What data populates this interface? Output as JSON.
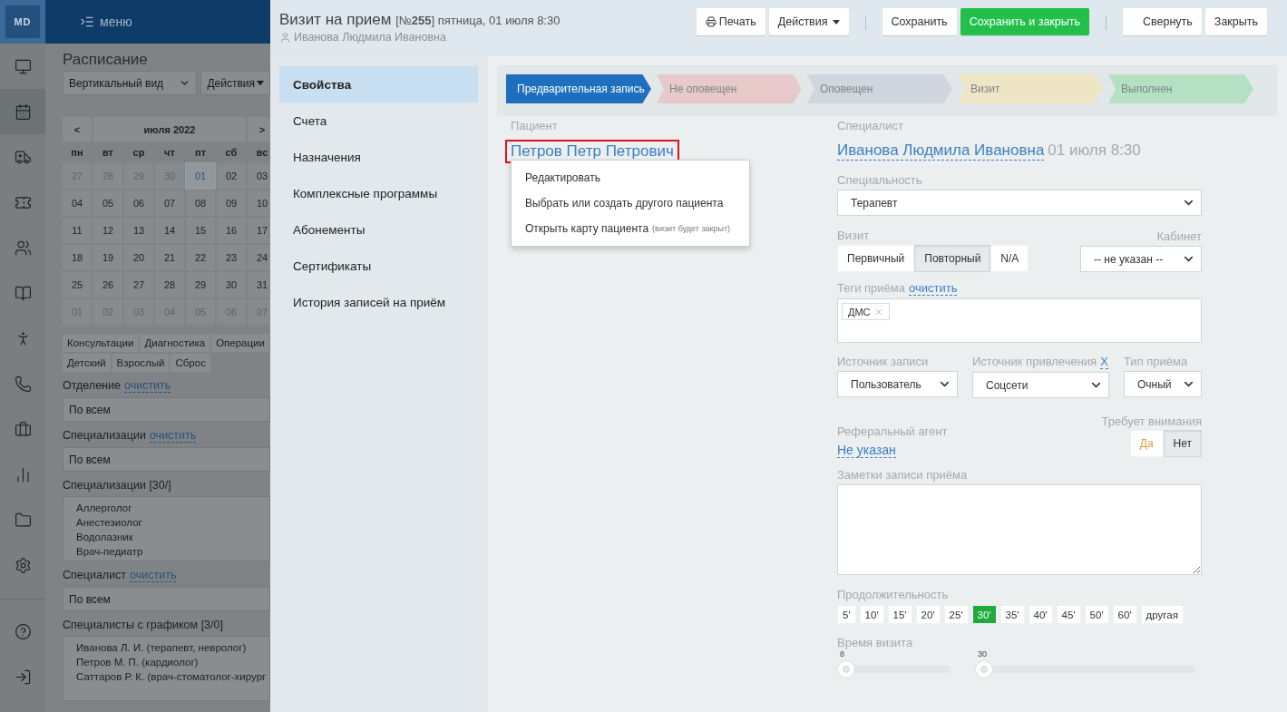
{
  "app_header": {
    "logo": "MD",
    "menu_label": "меню"
  },
  "nav_items": [
    {
      "selected": false
    },
    {
      "selected": true
    },
    {
      "selected": false
    },
    {
      "selected": false
    },
    {
      "selected": false
    },
    {
      "selected": false
    },
    {
      "selected": false
    },
    {
      "selected": false
    },
    {
      "selected": false
    },
    {
      "selected": false
    },
    {
      "selected": false
    },
    {
      "selected": false
    }
  ],
  "schedule": {
    "title": "Расписание",
    "view_select": "Вертикальный вид",
    "actions": "Действия",
    "calendar": {
      "month": "июля 2022",
      "prev": "<",
      "next": ">",
      "weekdays": [
        "пн",
        "вт",
        "ср",
        "чт",
        "пт",
        "сб",
        "вс"
      ],
      "weeks": [
        [
          {
            "day": "27",
            "muted": true,
            "selected": false
          },
          {
            "day": "28",
            "muted": true,
            "selected": false
          },
          {
            "day": "29",
            "muted": true,
            "selected": false
          },
          {
            "day": "30",
            "muted": true,
            "selected": false
          },
          {
            "day": "01",
            "muted": false,
            "selected": true
          },
          {
            "day": "02",
            "muted": false,
            "selected": false
          },
          {
            "day": "03",
            "muted": false,
            "selected": false
          }
        ],
        [
          {
            "day": "04",
            "muted": false,
            "selected": false
          },
          {
            "day": "05",
            "muted": false,
            "selected": false
          },
          {
            "day": "06",
            "muted": false,
            "selected": false
          },
          {
            "day": "07",
            "muted": false,
            "selected": false
          },
          {
            "day": "08",
            "muted": false,
            "selected": false
          },
          {
            "day": "09",
            "muted": false,
            "selected": false
          },
          {
            "day": "10",
            "muted": false,
            "selected": false
          }
        ],
        [
          {
            "day": "11",
            "muted": false,
            "selected": false
          },
          {
            "day": "12",
            "muted": false,
            "selected": false
          },
          {
            "day": "13",
            "muted": false,
            "selected": false
          },
          {
            "day": "14",
            "muted": false,
            "selected": false
          },
          {
            "day": "15",
            "muted": false,
            "selected": false
          },
          {
            "day": "16",
            "muted": false,
            "selected": false
          },
          {
            "day": "17",
            "muted": false,
            "selected": false
          }
        ],
        [
          {
            "day": "18",
            "muted": false,
            "selected": false
          },
          {
            "day": "19",
            "muted": false,
            "selected": false
          },
          {
            "day": "20",
            "muted": false,
            "selected": false
          },
          {
            "day": "21",
            "muted": false,
            "selected": false
          },
          {
            "day": "22",
            "muted": false,
            "selected": false
          },
          {
            "day": "23",
            "muted": false,
            "selected": false
          },
          {
            "day": "24",
            "muted": false,
            "selected": false
          }
        ],
        [
          {
            "day": "25",
            "muted": false,
            "selected": false
          },
          {
            "day": "26",
            "muted": false,
            "selected": false
          },
          {
            "day": "27",
            "muted": false,
            "selected": false
          },
          {
            "day": "28",
            "muted": false,
            "selected": false
          },
          {
            "day": "29",
            "muted": false,
            "selected": false
          },
          {
            "day": "30",
            "muted": false,
            "selected": false
          },
          {
            "day": "31",
            "muted": false,
            "selected": false
          }
        ],
        [
          {
            "day": "01",
            "muted": true,
            "selected": false
          },
          {
            "day": "02",
            "muted": true,
            "selected": false
          },
          {
            "day": "03",
            "muted": true,
            "selected": false
          },
          {
            "day": "04",
            "muted": true,
            "selected": false
          },
          {
            "day": "05",
            "muted": true,
            "selected": false
          },
          {
            "day": "06",
            "muted": true,
            "selected": false
          },
          {
            "day": "07",
            "muted": true,
            "selected": false
          }
        ]
      ]
    },
    "type_filters": [
      [
        "Консультации",
        "Диагностика",
        "Операции"
      ],
      [
        "Детский",
        "Взрослый",
        "Сброс"
      ]
    ],
    "filters": [
      {
        "kind": "select",
        "label": "Отделение",
        "clear": "очистить",
        "value": "По всем"
      },
      {
        "kind": "select",
        "label": "Специализации",
        "clear": "очистить",
        "value": "По всем"
      },
      {
        "kind": "list",
        "label": "Специализации [30/]",
        "items": [
          "Аллерголог",
          "Анестезиолог",
          "Водолазник",
          "Врач-педиатр"
        ]
      },
      {
        "kind": "select",
        "label": "Специалист",
        "clear": "очистить",
        "value": "По всем"
      },
      {
        "kind": "list",
        "label": "Специалисты с графиком [3/0]",
        "items": [
          "Иванова Л. И. (терапевт, невролог)",
          "Петров М. П. (кардиолог)",
          "Саттаров Р. К. (врач-стоматолог-хирург"
        ]
      }
    ]
  },
  "modal": {
    "title": "Визит на прием",
    "subtitle": "[№**255**] пятница, 01 июля 8:30",
    "author": "Иванова Людмила Ивановна",
    "toolbar": [
      {
        "kind": "print",
        "label": "Печать"
      },
      {
        "kind": "menu",
        "label": "Действия"
      },
      {
        "kind": "separator"
      },
      {
        "kind": "default",
        "label": "Сохранить"
      },
      {
        "kind": "primary",
        "label": "Сохранить и закрыть"
      },
      {
        "kind": "separator"
      },
      {
        "kind": "default",
        "label": "Свернуть"
      },
      {
        "kind": "default",
        "label": "Закрыть"
      }
    ],
    "tabs": [
      {
        "label": "Свойства",
        "selected": true
      },
      {
        "label": "Счета",
        "selected": false
      },
      {
        "label": "Назначения",
        "selected": false
      },
      {
        "label": "Комплексные программы",
        "selected": false
      },
      {
        "label": "Абонементы",
        "selected": false
      },
      {
        "label": "Сертификаты",
        "selected": false
      },
      {
        "label": "История записей на приём",
        "selected": false
      }
    ],
    "status_steps": [
      {
        "label": "Предварительная запись",
        "selected": true,
        "color": "#1f6fbf"
      },
      {
        "label": "Не оповещен",
        "selected": false,
        "color": "#e7c9c9"
      },
      {
        "label": "Оповещен",
        "selected": false,
        "color": "#d1d6de"
      },
      {
        "label": "Визит",
        "selected": false,
        "color": "#ede5c4"
      },
      {
        "label": "Выполнен",
        "selected": false,
        "color": "#b4e1c4"
      }
    ],
    "patient": {
      "label": "Пациент",
      "name": "Петров Петр Петрович",
      "highlighted": true,
      "menu": [
        {
          "label": "Редактировать"
        },
        {
          "label": "Выбрать или создать другого пациента"
        },
        {
          "label": "Открыть карту пациента",
          "note": "(визит будет закрыт)"
        }
      ]
    },
    "specialist": {
      "label": "Специалист",
      "name": "Иванова Людмила Ивановна",
      "datetime": "01 июля 8:30"
    },
    "specialty": {
      "label": "Специальность",
      "value": "Терапевт"
    },
    "visit": {
      "label": "Визит",
      "options": [
        {
          "label": "Первичный",
          "selected": false
        },
        {
          "label": "Повторный",
          "selected": true
        },
        {
          "label": "N/A",
          "selected": false
        }
      ]
    },
    "cabinet": {
      "label": "Кабинет",
      "value": "-- не указан --"
    },
    "tags": {
      "label": "Теги приёма",
      "clear": "очистить",
      "items": [
        "ДМС"
      ]
    },
    "selects": [
      {
        "label": "Источник записи",
        "value": "Пользователь"
      },
      {
        "label": "Источник привлечения",
        "clear": "Х",
        "value": "Соцсети"
      },
      {
        "label": "Тип приёма",
        "value": "Очный"
      }
    ],
    "referral": {
      "label": "Реферальный агент",
      "value": "Не указан"
    },
    "attention": {
      "label": "Требует внимания",
      "options": [
        {
          "label": "Да",
          "selected": false
        },
        {
          "label": "Нет",
          "selected": true
        }
      ]
    },
    "notes": {
      "label": "Заметки записи приёма"
    },
    "duration": {
      "label": "Продолжительность",
      "options": [
        {
          "label": "5'",
          "selected": false
        },
        {
          "label": "10'",
          "selected": false
        },
        {
          "label": "15'",
          "selected": false
        },
        {
          "label": "20'",
          "selected": false
        },
        {
          "label": "25'",
          "selected": false
        },
        {
          "label": "30'",
          "selected": true
        },
        {
          "label": "35'",
          "selected": false
        },
        {
          "label": "40'",
          "selected": false
        },
        {
          "label": "45'",
          "selected": false
        },
        {
          "label": "50'",
          "selected": false
        },
        {
          "label": "60'",
          "selected": false
        },
        {
          "label": "другая",
          "selected": false
        }
      ]
    },
    "visit_time": {
      "label": "Время визита",
      "sliders": [
        {
          "reading": "8",
          "level": 0
        },
        {
          "reading": "30",
          "level": 0
        }
      ]
    }
  }
}
